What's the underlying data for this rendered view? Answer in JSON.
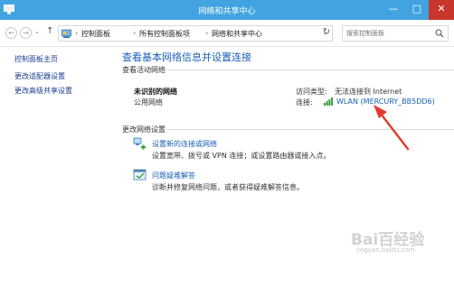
{
  "window": {
    "title": "网络和共享中心",
    "minimize_glyph": "—",
    "maximize_glyph": "□",
    "close_glyph": "✕"
  },
  "addressbar": {
    "back_glyph": "←",
    "forward_glyph": "→",
    "recent_glyph": "⌄",
    "up_glyph": "↑",
    "breadcrumb": [
      "控制面板",
      "所有控制面板项",
      "网络和共享中心"
    ],
    "breadcrumb_sep": "›",
    "dropdown_glyph": "⌄",
    "refresh_glyph": "↻",
    "search_placeholder": "搜索控制面板"
  },
  "sidebar": {
    "items": [
      {
        "label": "控制面板主页"
      },
      {
        "label": "更改适配器设置"
      },
      {
        "label": "更改高级共享设置"
      }
    ]
  },
  "main": {
    "title": "查看基本网络信息并设置连接",
    "active_networks_header": "查看活动网络",
    "network": {
      "name": "未识别的网络",
      "type": "公用网络",
      "access_label": "访问类型:",
      "access_value": "无法连接到 Internet",
      "connection_label": "连接:",
      "connection_value": "WLAN (MERCURY_BB5DD6)"
    },
    "change_settings_header": "更改网络设置",
    "tasks": [
      {
        "title": "设置新的连接或网络",
        "desc": "设置宽带、拨号或 VPN 连接；或设置路由器或接入点。",
        "icon": "network-setup-icon"
      },
      {
        "title": "问题疑难解答",
        "desc": "诊断并修复网络问题，或者获得疑难解答信息。",
        "icon": "troubleshoot-icon"
      }
    ]
  },
  "watermark": {
    "logo": "Bai百经验",
    "url": "jingyan.baidu.com"
  },
  "colors": {
    "titlebar": "#41a4e0",
    "link": "#1a5fb4",
    "annotation_arrow": "#e23a2c",
    "close_button": "#c8362c"
  }
}
